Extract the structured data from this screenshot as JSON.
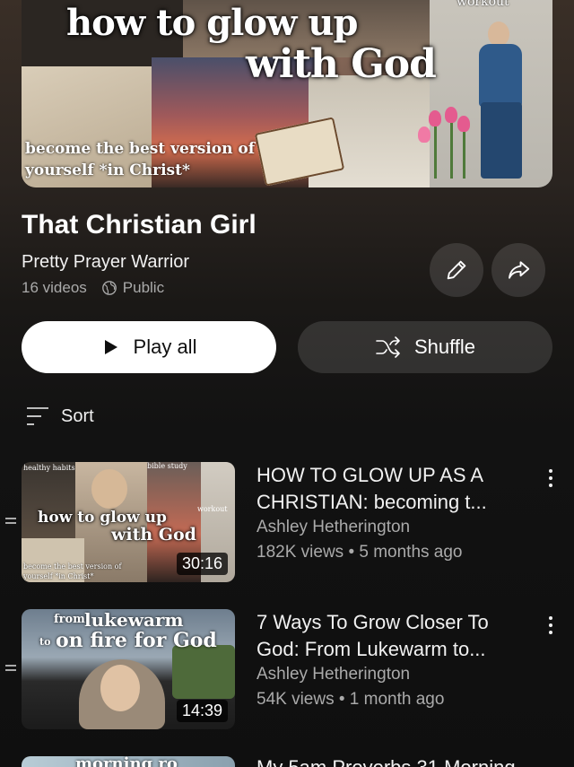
{
  "hero": {
    "title_line1": "how to glow up",
    "title_line2": "with God",
    "subtitle_line1": "become the best version of",
    "subtitle_line2": "yourself *in Christ*",
    "corner_label": "workout"
  },
  "playlist": {
    "title": "That Christian Girl",
    "owner": "Pretty Prayer Warrior",
    "video_count": "16 videos",
    "visibility": "Public",
    "edit_icon": "pencil-icon",
    "share_icon": "share-icon"
  },
  "actions": {
    "play_all_label": "Play all",
    "shuffle_label": "Shuffle"
  },
  "sort": {
    "label": "Sort"
  },
  "videos": [
    {
      "title_line1": "HOW TO GLOW UP AS A",
      "title_line2": "CHRISTIAN: becoming t...",
      "channel": "Ashley Hetherington",
      "stats": "182K views • 5 months ago",
      "duration": "30:16",
      "thumb": {
        "line1": "how to glow up",
        "line2": "with God",
        "tag1": "healthy habits",
        "tag2": "bible study",
        "tag3": "workout",
        "bottom1": "become the best version of",
        "bottom2": "yourself *in Christ*"
      }
    },
    {
      "title_line1": "7 Ways To Grow Closer To",
      "title_line2": "God: From Lukewarm to...",
      "channel": "Ashley Hetherington",
      "stats": "54K views • 1 month ago",
      "duration": "14:39",
      "thumb": {
        "from": "from",
        "lukewarm": "lukewarm",
        "to": "to",
        "on_fire": "on fire for God"
      }
    },
    {
      "title_line1": "My 5am Proverbs 31 Morning",
      "thumb": {
        "line1": "morning ro"
      }
    }
  ],
  "colors": {
    "background": "#0f0f0f",
    "accent_button": "#ffffff",
    "secondary_text": "#aaaaaa"
  }
}
